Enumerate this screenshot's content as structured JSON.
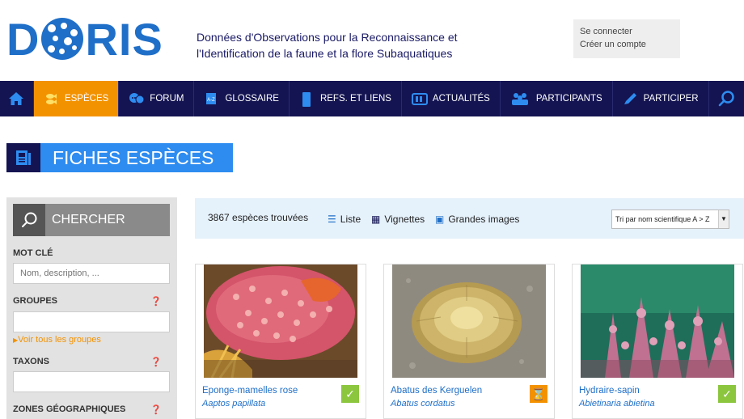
{
  "header": {
    "logo_text": "DORIS",
    "tagline_line1": "Données d'Observations pour la Reconnaissance et",
    "tagline_line2": "l'Identification de la faune et la flore Subaquatiques",
    "login": "Se connecter",
    "signup": "Créer un compte"
  },
  "nav": {
    "home_icon": "home-icon",
    "items": [
      {
        "label": "ESPÈCES",
        "icon": "fish-icon"
      },
      {
        "label": "FORUM",
        "icon": "chat-icon"
      },
      {
        "label": "GLOSSAIRE",
        "icon": "book-icon"
      },
      {
        "label": "REFS. ET LIENS",
        "icon": "bookmark-icon"
      },
      {
        "label": "ACTUALITÉS",
        "icon": "news-icon"
      },
      {
        "label": "PARTICIPANTS",
        "icon": "people-icon"
      },
      {
        "label": "PARTICIPER",
        "icon": "pen-icon"
      }
    ],
    "search_icon": "search-icon",
    "active_color": "#f39200",
    "bg_color": "#141452"
  },
  "page_title": "FICHES ESPÈCES",
  "sidebar": {
    "search_label": "CHERCHER",
    "keyword_label": "MOT CLÉ",
    "keyword_placeholder": "Nom, description, ...",
    "groups_label": "GROUPES",
    "all_groups_link": "Voir tous les groupes",
    "taxons_label": "TAXONS",
    "zones_label": "ZONES GÉOGRAPHIQUES"
  },
  "results": {
    "count_text": "3867 espèces trouvées",
    "view_list": "Liste",
    "view_thumbs": "Vignettes",
    "view_large": "Grandes images",
    "sort_value": "Tri par nom scientifique A > Z"
  },
  "cards": [
    {
      "name": "Eponge-mamelles rose",
      "sci": "Aaptos papillata",
      "status": "validated",
      "badge_color": "#8cc63f"
    },
    {
      "name": "Abatus des Kerguelen",
      "sci": "Abatus cordatus",
      "status": "pending",
      "badge_color": "#f39200"
    },
    {
      "name": "Hydraire-sapin",
      "sci": "Abietinaria abietina",
      "status": "validated",
      "badge_color": "#8cc63f"
    }
  ]
}
